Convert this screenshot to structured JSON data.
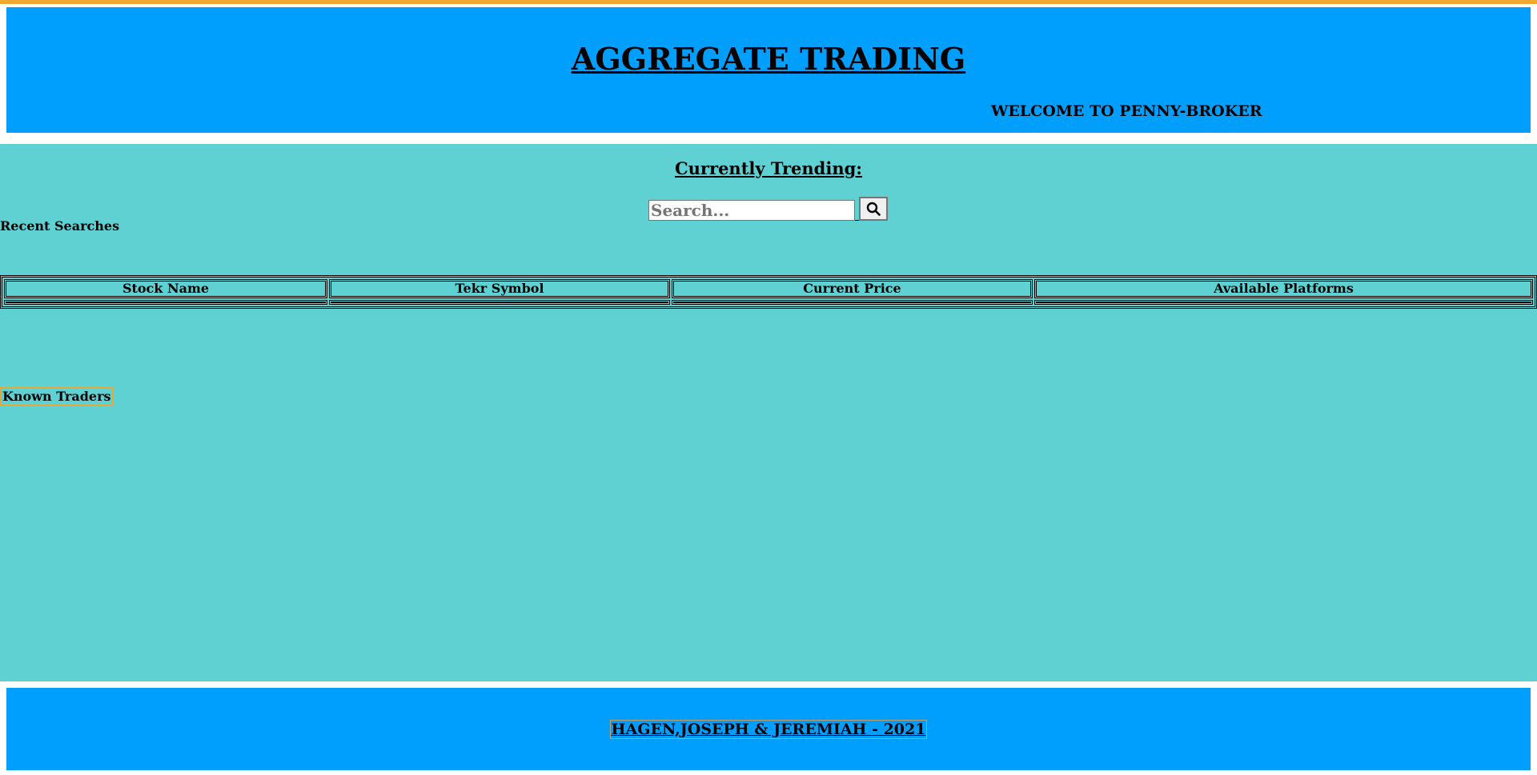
{
  "header": {
    "title": "AGGREGATE TRADING",
    "welcome": "WELCOME TO PENNY-BROKER"
  },
  "main": {
    "trending_heading": "Currently Trending:",
    "search": {
      "placeholder": "Search...",
      "value": "",
      "button_icon": "search-icon"
    },
    "recent_searches_label": "Recent Searches",
    "table": {
      "columns": [
        "Stock Name",
        "Tekr Symbol",
        "Current Price",
        "Available Platforms"
      ],
      "rows": []
    },
    "known_traders_label": "Known Traders"
  },
  "footer": {
    "credits": "HAGEN,JOSEPH & JEREMIAH - 2021"
  },
  "colors": {
    "header_bg": "#009ffd",
    "main_bg": "#5fd1d2",
    "accent": "#f0a830"
  }
}
